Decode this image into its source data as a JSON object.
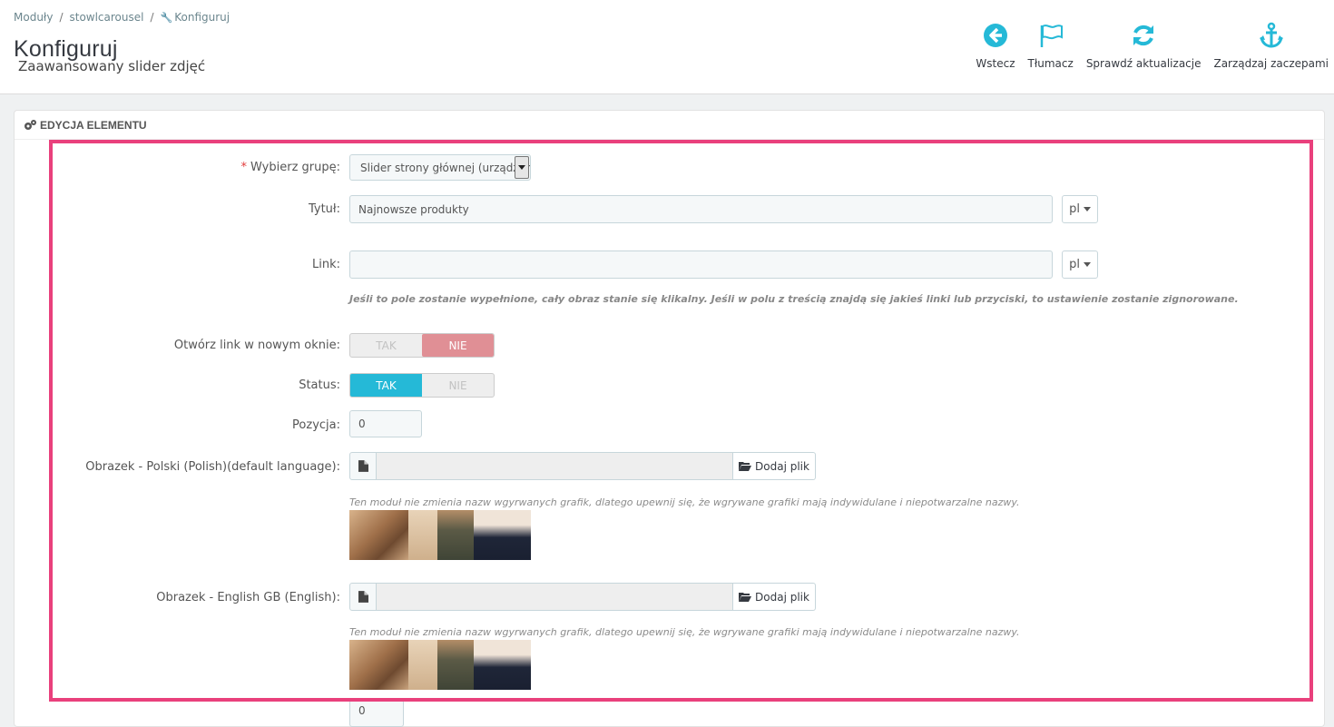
{
  "breadcrumb": [
    "Moduły",
    "stowlcarousel",
    "Konfiguruj"
  ],
  "page": {
    "title": "Konfiguruj",
    "subtitle": "Zaawansowany slider zdjęć"
  },
  "toolbar": {
    "back": "Wstecz",
    "translate": "Tłumacz",
    "check_updates": "Sprawdź aktualizacje",
    "manage_hooks": "Zarządzaj zaczepami"
  },
  "panel": {
    "heading": "Edycja elementu"
  },
  "form": {
    "group_label": "Wybierz grupę:",
    "group_value": "Slider strony głównej (urządzenia",
    "title_label": "Tytuł:",
    "title_value": "Najnowsze produkty",
    "lang": "pl",
    "link_label": "Link:",
    "link_value": "",
    "link_help": "Jeśli to pole zostanie wypełnione, cały obraz stanie się klikalny. Jeśli w polu z treścią znajdą się jakieś linki lub przyciski, to ustawienie zostanie zignorowane.",
    "new_window_label": "Otwórz link w nowym oknie:",
    "status_label": "Status:",
    "yes": "TAK",
    "no": "NIE",
    "position_label": "Pozycja:",
    "position_value": "0",
    "image_pl_label": "Obrazek - Polski (Polish)(default language):",
    "image_en_label": "Obrazek - English GB (English):",
    "add_file": "Dodaj plik",
    "image_help": "Ten moduł nie zmienia nazw wgyrwanych grafik, dlatego upewnij się, że wgrywane grafiki mają indywidulane i niepotwarzalne nazwy.",
    "next_value": "0"
  },
  "colors": {
    "accent": "#25b9d7",
    "highlight": "#e9407c",
    "off_red": "#e08f95"
  }
}
